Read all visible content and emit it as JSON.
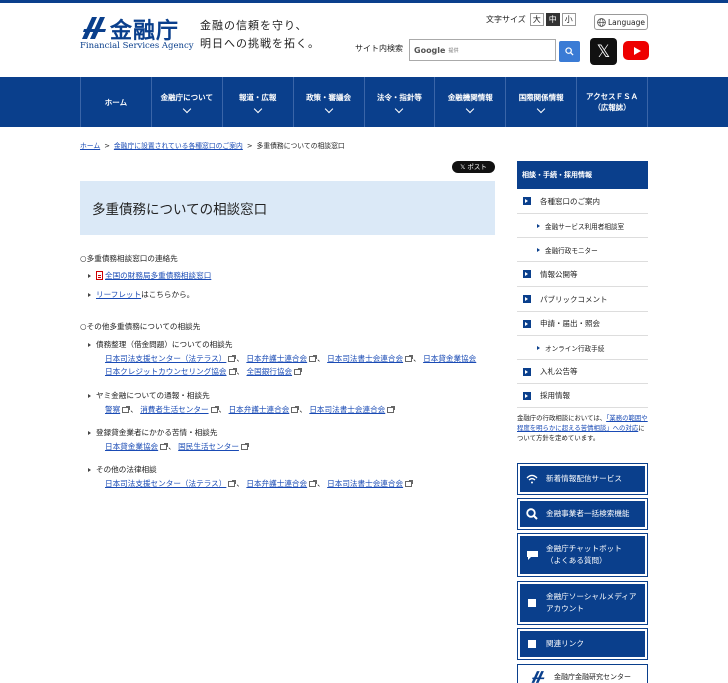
{
  "header": {
    "logo_jp": "金融庁",
    "logo_en": "Financial Services Agency",
    "slogan_line1": "金融の信頼を守り、",
    "slogan_line2": "明日への挑戦を拓く。",
    "fontsize_label": "文字サイズ",
    "fontsize_options": [
      "大",
      "中",
      "小"
    ],
    "fontsize_selected": "中",
    "language_label": "Language",
    "search_label": "サイト内検索",
    "search_engine": "Google",
    "search_provider_text": "提供",
    "brand_color": "#0a3f8c"
  },
  "nav": {
    "items": [
      {
        "label": "ホーム",
        "has_dropdown": false
      },
      {
        "label": "金融庁について",
        "has_dropdown": true
      },
      {
        "label": "報道・広報",
        "has_dropdown": true
      },
      {
        "label": "政策・審議会",
        "has_dropdown": true
      },
      {
        "label": "法令・指針等",
        "has_dropdown": true
      },
      {
        "label": "金融機関情報",
        "has_dropdown": true
      },
      {
        "label": "国際関係情報",
        "has_dropdown": true
      },
      {
        "label": "アクセスＦＳＡ\n（広報誌）",
        "has_dropdown": false
      }
    ]
  },
  "breadcrumb": {
    "home": "ホーム",
    "parent": "金融庁に設置されている各種窓口のご案内",
    "current": "多重債務についての相談窓口"
  },
  "post_button": "ポスト",
  "page_title": "多重債務についての相談窓口",
  "main": {
    "section1_title": "○多重債務相談窓口の連絡先",
    "section1_link1": "全国の財務局多重債務相談窓口",
    "section1_link2": "リーフレット",
    "section1_link2_suffix": "はこちらから。",
    "section2_title": "○その他多重債務についての相談先",
    "groups": [
      {
        "heading": "債務整理（借金問題）についての相談先",
        "line1": [
          "日本司法支援センター（法テラス）",
          "日本弁護士連合会",
          "日本司法書士会連合会",
          "日本貸金業協会"
        ],
        "line2": [
          "日本クレジットカウンセリング協会",
          "全国銀行協会"
        ]
      },
      {
        "heading": "ヤミ金融についての通報・相談先",
        "line1": [
          "警察",
          "消費者生活センター",
          "日本弁護士連合会",
          "日本司法書士会連合会"
        ],
        "line2": []
      },
      {
        "heading": "登録貸金業者にかかる苦情・相談先",
        "line1": [
          "日本貸金業協会",
          "国民生活センター"
        ],
        "line2": []
      },
      {
        "heading": "その他の法律相談",
        "line1": [
          "日本司法支援センター（法テラス）",
          "日本弁護士連合会",
          "日本司法書士会連合会"
        ],
        "line2": []
      }
    ],
    "separator": "、"
  },
  "sidebar": {
    "heading": "相談・手続・採用情報",
    "items": [
      {
        "label": "各種窓口のご案内",
        "sub": false
      },
      {
        "label": "金融サービス利用者相談室",
        "sub": true
      },
      {
        "label": "金融行政モニター",
        "sub": true
      },
      {
        "label": "情報公開等",
        "sub": false
      },
      {
        "label": "パブリックコメント",
        "sub": false
      },
      {
        "label": "申請・届出・照会",
        "sub": false
      },
      {
        "label": "オンライン行政手続",
        "sub": true
      },
      {
        "label": "入札公告等",
        "sub": false
      },
      {
        "label": "採用情報",
        "sub": false
      }
    ],
    "note_prefix": "金融庁の行政相談においては、",
    "note_link": "「業務の範囲や程度を明らかに超える苦情相談」への対応",
    "note_suffix": "について方針を定めています。",
    "buttons": [
      {
        "label": "新着情報配信サービス",
        "icon": "wifi-icon"
      },
      {
        "label": "金融事業者一括検索機能",
        "icon": "search-icon"
      },
      {
        "label": "金融庁チャットボット\n（よくある質問）",
        "icon": "chat-icon"
      },
      {
        "label": "金融庁ソーシャルメディア\nアカウント",
        "icon": "share-icon"
      },
      {
        "label": "関連リンク",
        "icon": "link-icon"
      }
    ],
    "research_center": "金融庁金融研究センター"
  }
}
